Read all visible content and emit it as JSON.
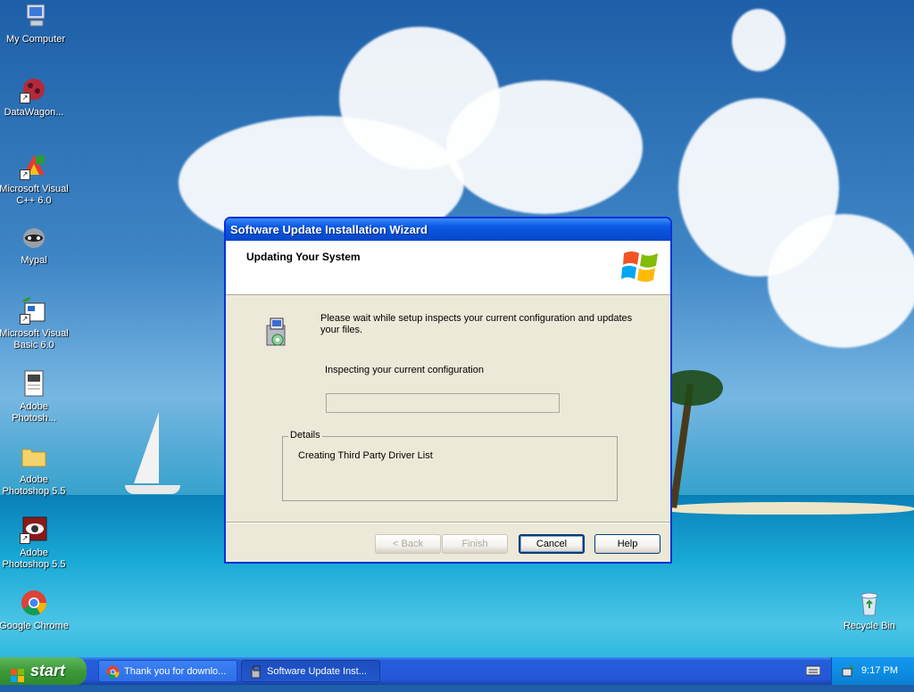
{
  "desktop": {
    "icons": [
      {
        "label": "My Computer",
        "icon": "computer-icon"
      },
      {
        "label": "DataWagon...",
        "icon": "datawagon-icon"
      },
      {
        "label": "Microsoft Visual C++ 6.0",
        "icon": "visual-cpp-icon"
      },
      {
        "label": "Mypal",
        "icon": "mypal-icon"
      },
      {
        "label": "Microsoft Visual Basic 6.0",
        "icon": "visual-basic-icon"
      },
      {
        "label": "Adobe Photosh...",
        "icon": "document-icon"
      },
      {
        "label": "Adobe Photoshop 5.5",
        "icon": "folder-icon"
      },
      {
        "label": "Adobe Photoshop 5.5",
        "icon": "photoshop-eye-icon"
      },
      {
        "label": "Google Chrome",
        "icon": "chrome-icon"
      },
      {
        "label": "Recycle Bin",
        "icon": "recycle-bin-icon"
      }
    ]
  },
  "wizard": {
    "title": "Software Update Installation Wizard",
    "header_title": "Updating Your System",
    "message": "Please wait while setup inspects your current configuration and updates your files.",
    "status": "Inspecting your current configuration",
    "progress": 0,
    "details_label": "Details",
    "details_text": "Creating Third Party Driver List",
    "buttons": {
      "back": "< Back",
      "finish": "Finish",
      "cancel": "Cancel",
      "help": "Help"
    }
  },
  "taskbar": {
    "start_label": "start",
    "tasks": [
      {
        "label": "Thank you for downlo...",
        "icon": "chrome-icon",
        "active": false
      },
      {
        "label": "Software Update Inst...",
        "icon": "installer-icon",
        "active": true
      }
    ],
    "clock": "9:17 PM"
  },
  "colors": {
    "titlebar": "#0a5ae5",
    "window_bg": "#ece9d8",
    "taskbar": "#245edb",
    "start_button": "#3c9a3a"
  }
}
